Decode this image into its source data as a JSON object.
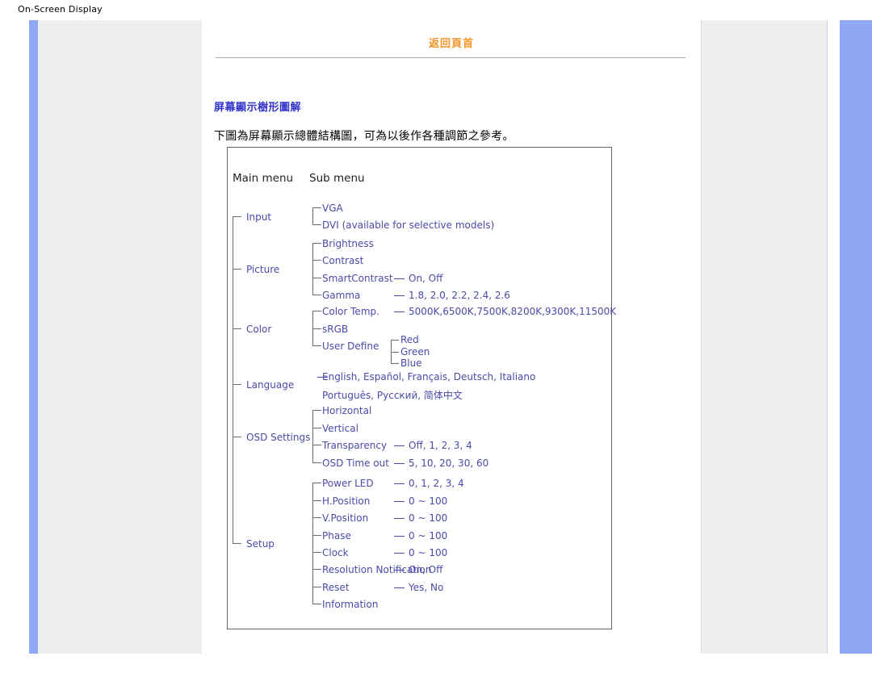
{
  "page": {
    "title": "On-Screen Display"
  },
  "header": {
    "back_to_top_label": "返回頁首"
  },
  "section": {
    "heading": "屏幕顯示樹形圖解",
    "paragraph": "下圖為屏幕顯示總體結構圖，可為以後作各種調節之參考。"
  },
  "colors": {
    "link_orange": "#f39322",
    "heading_blue": "#3333cc",
    "tree_blue": "#4a4aa8",
    "sidebar_blue": "#8fa8f5",
    "sidebar_gray": "#eeeeee",
    "box_border": "#666666"
  },
  "diagram": {
    "columns": {
      "main_menu": "Main menu",
      "sub_menu": "Sub menu"
    },
    "sections": [
      {
        "main": "Input",
        "items": [
          {
            "label": "VGA",
            "values": ""
          },
          {
            "label": "DVI (available for selective models)",
            "values": ""
          }
        ]
      },
      {
        "main": "Picture",
        "items": [
          {
            "label": "Brightness",
            "values": ""
          },
          {
            "label": "Contrast",
            "values": ""
          },
          {
            "label": "SmartContrast",
            "values": "On, Off"
          },
          {
            "label": "Gamma",
            "values": "1.8, 2.0, 2.2, 2.4, 2.6"
          }
        ]
      },
      {
        "main": "Color",
        "items": [
          {
            "label": "Color Temp.",
            "values": "5000K,6500K,7500K,8200K,9300K,11500K"
          },
          {
            "label": "sRGB",
            "values": ""
          },
          {
            "label": "User Define",
            "values": "",
            "leaves": [
              "Red",
              "Green",
              "Blue"
            ]
          }
        ]
      },
      {
        "main": "Language",
        "items": [
          {
            "label": "",
            "values": "English, Español, Français, Deutsch, Italiano"
          },
          {
            "label": "",
            "values": "Português, Русский, 简体中文"
          }
        ]
      },
      {
        "main": "OSD Settings",
        "items": [
          {
            "label": "Horizontal",
            "values": ""
          },
          {
            "label": "Vertical",
            "values": ""
          },
          {
            "label": "Transparency",
            "values": "Off, 1, 2, 3, 4"
          },
          {
            "label": "OSD Time out",
            "values": "5, 10, 20, 30, 60"
          }
        ]
      },
      {
        "main": "Setup",
        "items": [
          {
            "label": "Power LED",
            "values": "0, 1, 2, 3, 4"
          },
          {
            "label": "H.Position",
            "values": "0 ~ 100"
          },
          {
            "label": "V.Position",
            "values": "0 ~ 100"
          },
          {
            "label": "Phase",
            "values": "0 ~ 100"
          },
          {
            "label": "Clock",
            "values": "0 ~ 100"
          },
          {
            "label": "Resolution Notification",
            "values": "On, Off"
          },
          {
            "label": "Reset",
            "values": "Yes, No"
          },
          {
            "label": "Information",
            "values": ""
          }
        ]
      }
    ]
  }
}
